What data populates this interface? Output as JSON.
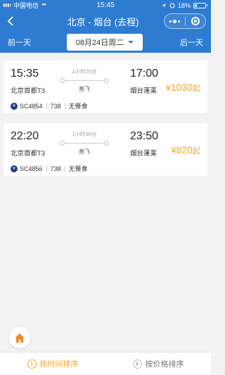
{
  "status_bar": {
    "carrier": "中国电信",
    "time": "15:45",
    "battery": "18%",
    "battery_level": 0.18
  },
  "nav": {
    "title": "北京 - 烟台 (去程)"
  },
  "date_bar": {
    "prev_label": "前一天",
    "date_label": "08月24日周二",
    "next_label": "后一天"
  },
  "flights": [
    {
      "dep_time": "15:35",
      "dep_airport": "北京首都T3",
      "duration": "1小时25分",
      "stop_type": "直飞",
      "arr_time": "17:00",
      "arr_airport": "烟台蓬莱",
      "price_currency": "¥",
      "price_value": "1030",
      "price_suffix": "起",
      "flight_no": "SC4854",
      "aircraft": "738",
      "meal": "无餐食"
    },
    {
      "dep_time": "22:20",
      "dep_airport": "北京首都T3",
      "duration": "1小时30分",
      "stop_type": "直飞",
      "arr_time": "23:50",
      "arr_airport": "烟台蓬莱",
      "price_currency": "¥",
      "price_value": "820",
      "price_suffix": "起",
      "flight_no": "SC4856",
      "aircraft": "738",
      "meal": "无餐食"
    }
  ],
  "bottom_bar": {
    "sort_time_label": "按时间排序",
    "sort_price_label": "按价格排序"
  },
  "colors": {
    "brand": "#2e7cd1",
    "accent": "#f5a623"
  },
  "icons": [
    "back-icon",
    "more-icon",
    "target-icon",
    "caret-down-icon",
    "airline-logo-icon",
    "home-icon",
    "clock-icon",
    "yen-icon"
  ]
}
